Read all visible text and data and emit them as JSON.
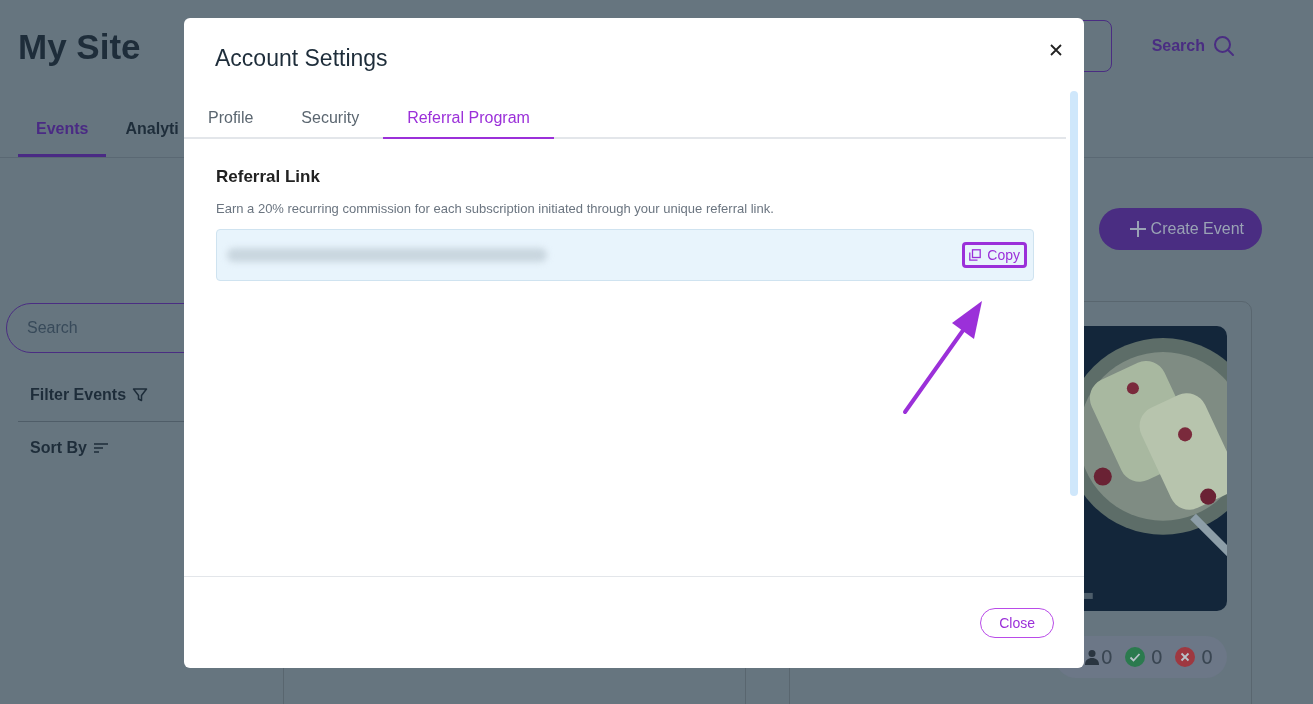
{
  "site_title": "My Site",
  "header_search": "Search",
  "nav_tabs": [
    {
      "label": "Events",
      "selected": true
    },
    {
      "label": "Analyti",
      "selected": false
    }
  ],
  "create_button": "Create Event",
  "search": {
    "placeholder": "Search"
  },
  "filter_label": "Filter Events",
  "sort_label": "Sort By",
  "event_stats": [
    {
      "kind": "attendees",
      "value": "0"
    },
    {
      "kind": "approved",
      "value": "0"
    },
    {
      "kind": "declined",
      "value": "0"
    }
  ],
  "modal": {
    "title": "Account Settings",
    "tabs": [
      {
        "label": "Profile",
        "selected": false
      },
      {
        "label": "Security",
        "selected": false
      },
      {
        "label": "Referral Program",
        "selected": true
      }
    ],
    "section_title": "Referral Link",
    "description": "Earn a 20% recurring commission for each subscription initiated through your unique referral link.",
    "copy_button": "Copy",
    "close_button": "Close"
  }
}
